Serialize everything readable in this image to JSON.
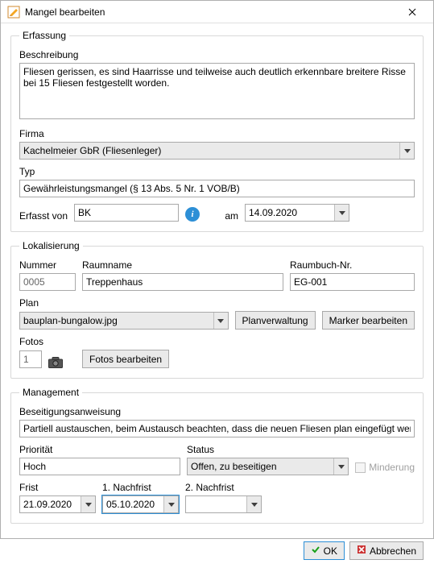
{
  "window": {
    "title": "Mangel bearbeiten"
  },
  "erfassung": {
    "legend": "Erfassung",
    "beschreibung_label": "Beschreibung",
    "beschreibung_value": "Fliesen gerissen, es sind Haarrisse und teilweise auch deutlich erkennbare breitere Risse bei 15 Fliesen festgestellt worden.",
    "firma_label": "Firma",
    "firma_value": "Kachelmeier GbR (Fliesenleger)",
    "typ_label": "Typ",
    "typ_value": "Gewährleistungsmangel (§ 13 Abs. 5 Nr. 1 VOB/B)",
    "erfasst_von_label": "Erfasst von",
    "erfasst_von_value": "BK",
    "am_label": "am",
    "am_value": "14.09.2020"
  },
  "lokalisierung": {
    "legend": "Lokalisierung",
    "nummer_label": "Nummer",
    "nummer_value": "0005",
    "raumname_label": "Raumname",
    "raumname_value": "Treppenhaus",
    "raumbuch_label": "Raumbuch-Nr.",
    "raumbuch_value": "EG-001",
    "plan_label": "Plan",
    "plan_value": "bauplan-bungalow.jpg",
    "planverwaltung_btn": "Planverwaltung",
    "marker_btn": "Marker bearbeiten",
    "fotos_label": "Fotos",
    "fotos_count": "1",
    "fotos_btn": "Fotos bearbeiten"
  },
  "management": {
    "legend": "Management",
    "anweisung_label": "Beseitigungsanweisung",
    "anweisung_value": "Partiell austauschen, beim Austausch beachten, dass die neuen Fliesen plan eingefügt werden.",
    "prio_label": "Priorität",
    "prio_value": "Hoch",
    "status_label": "Status",
    "status_value": "Offen, zu beseitigen",
    "minderung_label": "Minderung",
    "frist_label": "Frist",
    "frist_value": "21.09.2020",
    "nachfrist1_label": "1. Nachfrist",
    "nachfrist1_value": "05.10.2020",
    "nachfrist2_label": "2. Nachfrist",
    "nachfrist2_value": ""
  },
  "footer": {
    "ok": "OK",
    "cancel": "Abbrechen"
  }
}
